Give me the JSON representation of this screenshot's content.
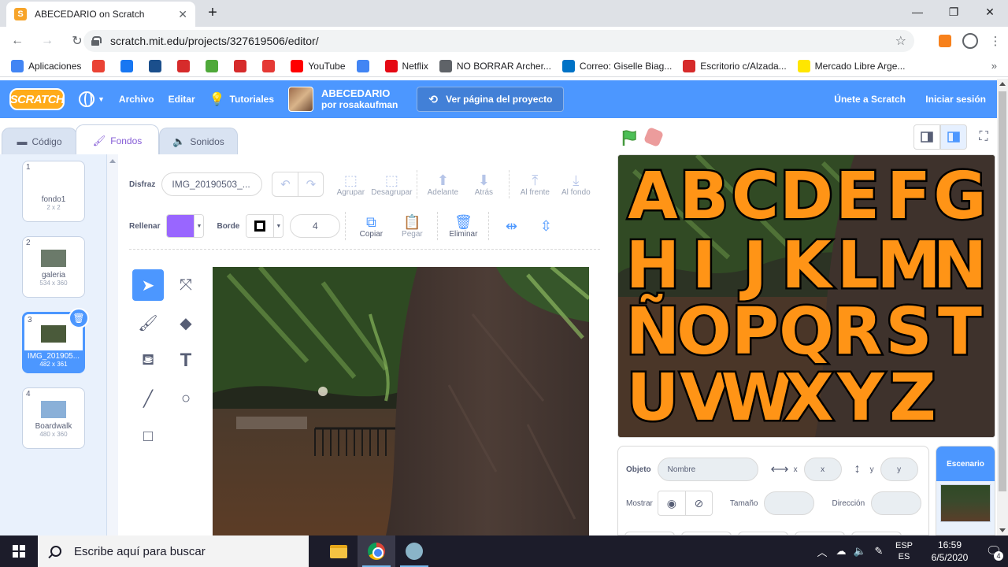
{
  "browser": {
    "tab_title": "ABECEDARIO on Scratch",
    "url": "scratch.mit.edu/projects/327619506/editor/",
    "bookmarks": [
      {
        "label": "Aplicaciones",
        "icon": "apps-grid-icon",
        "color": "#4285f4"
      },
      {
        "label": "",
        "icon": "maps-icon",
        "color": "#ea4335"
      },
      {
        "label": "",
        "icon": "facebook-icon",
        "color": "#1877f2"
      },
      {
        "label": "",
        "icon": "ln-icon",
        "color": "#1b4f8c"
      },
      {
        "label": "",
        "icon": "ec-icon",
        "color": "#d62b2b"
      },
      {
        "label": "",
        "icon": "ole-icon",
        "color": "#4fa93a"
      },
      {
        "label": "",
        "icon": "circle-site-icon",
        "color": "#d62b2b"
      },
      {
        "label": "",
        "icon": "red-site-icon",
        "color": "#e53935"
      },
      {
        "label": "YouTube",
        "icon": "youtube-icon",
        "color": "#ff0000"
      },
      {
        "label": "",
        "icon": "google-icon",
        "color": "#4285f4"
      },
      {
        "label": "Netflix",
        "icon": "netflix-icon",
        "color": "#e50914"
      },
      {
        "label": "NO BORRAR Archer...",
        "icon": "globe-icon",
        "color": "#5f6368"
      },
      {
        "label": "Correo: Giselle Biag...",
        "icon": "outlook-icon",
        "color": "#0072c6"
      },
      {
        "label": "Escritorio c/Alzada...",
        "icon": "site-icon",
        "color": "#d62b2b"
      },
      {
        "label": "Mercado Libre Arge...",
        "icon": "mercadolibre-icon",
        "color": "#ffe600"
      }
    ]
  },
  "menubar": {
    "logo": "SCRATCH",
    "file": "Archivo",
    "edit": "Editar",
    "tutorials": "Tutoriales",
    "project_title": "ABECEDARIO",
    "project_author": "por rosakaufman",
    "see_project": "Ver página del proyecto",
    "join": "Únete a Scratch",
    "signin": "Iniciar sesión"
  },
  "tabs": {
    "code": "Código",
    "costumes": "Fondos",
    "sounds": "Sonidos"
  },
  "costumes": [
    {
      "num": "1",
      "name": "fondo1",
      "size": "2 x 2",
      "thumb": "#ffffff"
    },
    {
      "num": "2",
      "name": "galeria",
      "size": "534 x 360",
      "thumb": "#6b7a6a"
    },
    {
      "num": "3",
      "name": "IMG_201905...",
      "size": "482 x 361",
      "thumb": "#4a5a3a"
    },
    {
      "num": "4",
      "name": "Boardwalk",
      "size": "480 x 360",
      "thumb": "#8ab0d8"
    }
  ],
  "paint": {
    "costume_label": "Disfraz",
    "costume_name": "IMG_20190503_...",
    "group": "Agrupar",
    "ungroup": "Desagrupar",
    "forward": "Adelante",
    "backward": "Atrás",
    "front": "Al frente",
    "back": "Al fondo",
    "fill_label": "Rellenar",
    "fill_color": "#9966ff",
    "outline_label": "Borde",
    "outline_color": "#000000",
    "outline_width": "4",
    "copy": "Copiar",
    "paste": "Pegar",
    "delete": "Eliminar"
  },
  "stage_letters": [
    "ABCDEFG",
    "HIJKLMN",
    "ÑOPQRST",
    "UVWXYZ"
  ],
  "sprite_info": {
    "sprite_label": "Objeto",
    "name_placeholder": "Nombre",
    "x_label": "x",
    "x_placeholder": "x",
    "y_label": "y",
    "y_placeholder": "y",
    "show_label": "Mostrar",
    "size_label": "Tamaño",
    "direction_label": "Dirección"
  },
  "stage_target": {
    "label": "Escenario"
  },
  "taskbar": {
    "search_placeholder": "Escribe aquí para buscar",
    "lang_top": "ESP",
    "lang_bottom": "ES",
    "time": "16:59",
    "date": "6/5/2020",
    "notifications": "4"
  },
  "colors": {
    "scratch_blue": "#4c97ff",
    "letter_orange": "#ff9416"
  }
}
